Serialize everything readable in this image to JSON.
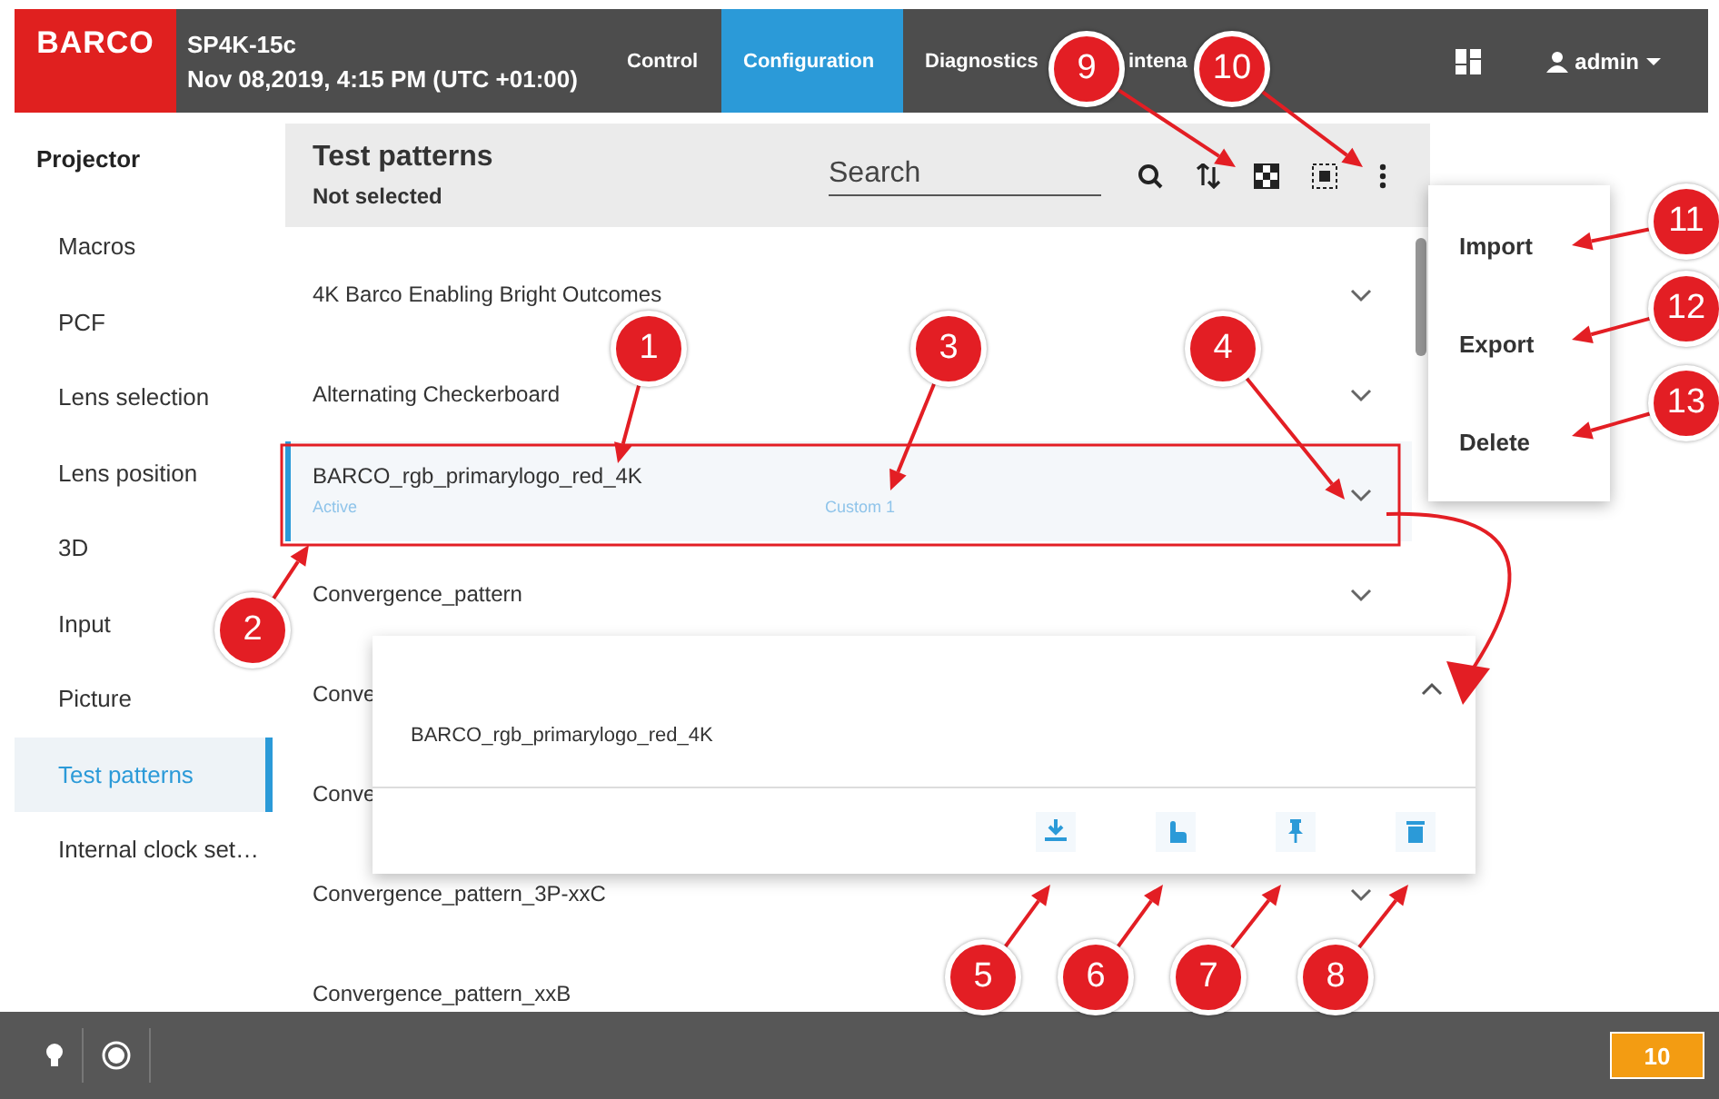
{
  "header": {
    "logo": "BARCO",
    "device": "SP4K-15c",
    "datetime": "Nov 08,2019, 4:15 PM (UTC +01:00)",
    "user": "admin"
  },
  "tabs": [
    {
      "label": "Control",
      "selected": false
    },
    {
      "label": "Configuration",
      "selected": true
    },
    {
      "label": "Diagnostics",
      "selected": false
    },
    {
      "label": "intena",
      "selected": false
    }
  ],
  "sidebar": {
    "title": "Projector",
    "items": [
      {
        "label": "Macros",
        "selected": false
      },
      {
        "label": "PCF",
        "selected": false
      },
      {
        "label": "Lens selection",
        "selected": false
      },
      {
        "label": "Lens position",
        "selected": false
      },
      {
        "label": "3D",
        "selected": false
      },
      {
        "label": "Input",
        "selected": false
      },
      {
        "label": "Picture",
        "selected": false
      },
      {
        "label": "Test patterns",
        "selected": true
      },
      {
        "label": "Internal clock set…",
        "selected": false
      }
    ]
  },
  "panel": {
    "title": "Test patterns",
    "subtitle": "Not selected",
    "search": {
      "placeholder": "Search"
    }
  },
  "patterns": [
    {
      "name": "4K Barco Enabling Bright Outcomes",
      "selected": false
    },
    {
      "name": "Alternating Checkerboard",
      "selected": false
    },
    {
      "name": "BARCO_rgb_primarylogo_red_4K",
      "selected": true,
      "status": "Active",
      "slot": "Custom 1"
    },
    {
      "name": "Convergence_pattern",
      "selected": false
    },
    {
      "name": "Conve",
      "selected": false
    },
    {
      "name": "Conve",
      "selected": false
    },
    {
      "name": "Convergence_pattern_3P-xxC",
      "selected": false
    },
    {
      "name": "Convergence_pattern_xxB",
      "selected": false
    }
  ],
  "detail": {
    "name": "BARCO_rgb_primarylogo_red_4K"
  },
  "menu": [
    {
      "label": "Import"
    },
    {
      "label": "Export"
    },
    {
      "label": "Delete"
    }
  ],
  "status_bar": {
    "badge": "10"
  },
  "callouts": [
    {
      "label": "1"
    },
    {
      "label": "2"
    },
    {
      "label": "3"
    },
    {
      "label": "4"
    },
    {
      "label": "5"
    },
    {
      "label": "6"
    },
    {
      "label": "7"
    },
    {
      "label": "8"
    },
    {
      "label": "9"
    },
    {
      "label": "10"
    },
    {
      "label": "11"
    },
    {
      "label": "12"
    },
    {
      "label": "13"
    }
  ]
}
